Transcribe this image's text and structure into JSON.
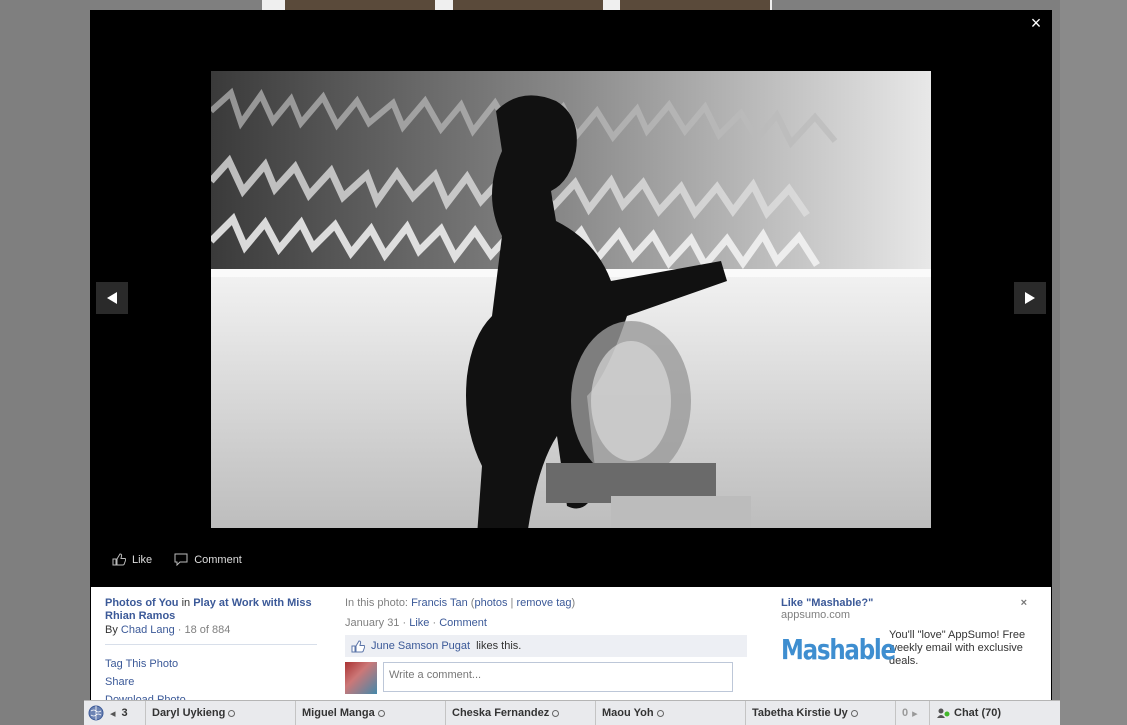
{
  "theater": {
    "close_label": "×",
    "actions": {
      "like_label": "Like",
      "comment_label": "Comment"
    }
  },
  "info": {
    "album_prefix": "Photos of You",
    "album_in": "in",
    "album_name": "Play at Work with Miss Rhian Ramos",
    "by_label": "By",
    "author": "Chad Lang",
    "position": "· 18 of 884",
    "links": [
      "Tag This Photo",
      "Share",
      "Download Photo"
    ]
  },
  "tags": {
    "prefix": "In this photo:",
    "name": "Francis Tan",
    "photos_label": "photos",
    "remove_label": "remove tag",
    "date": "January 31",
    "like_label": "Like",
    "comment_label": "Comment"
  },
  "likes": {
    "name": "June Samson Pugat",
    "suffix": "likes this."
  },
  "comment_input": {
    "placeholder": "Write a comment..."
  },
  "ad": {
    "title": "Like \"Mashable?\"",
    "url": "appsumo.com",
    "logo": "Mashable",
    "body": "You'll \"love\" AppSumo! Free weekly email with exclusive deals.",
    "close": "×"
  },
  "chatbar": {
    "count": "3",
    "friends": [
      "Daryl Uykieng",
      "Miguel Manga",
      "Cheska Fernandez",
      "Maou Yoh",
      "Tabetha Kirstie Uy"
    ],
    "overflow": "0",
    "chat_label": "Chat (70)"
  },
  "colors": {
    "link": "#3b5998",
    "theater_bg": "#000000",
    "chat_online": "#42b72a"
  }
}
